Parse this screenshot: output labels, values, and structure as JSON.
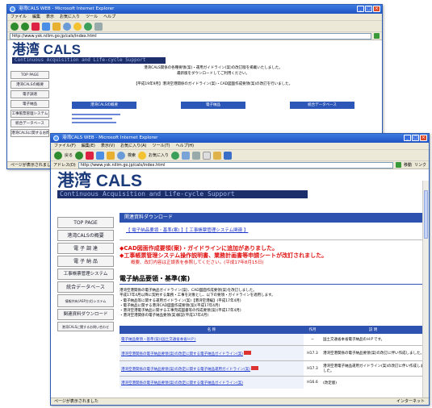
{
  "back": {
    "title": "港湾CALS WEB - Microsoft Internet Explorer",
    "menu": [
      "ファイル",
      "編集",
      "表示",
      "お気に入り",
      "ツール",
      "ヘルプ"
    ],
    "address": "http://www.ysk.nilim.go.jp/cals/index.html",
    "logo": "港湾 CALS",
    "subtitle": "Continuous Acquisition and Life-cycle Support",
    "notice1": "港湾CALS関係の各種要領(案)・運用ガイドライン(案)の改訂版を掲載いたしました。",
    "notice2": "最新版をダウンロードしてご利用ください。",
    "notice3": "【平成19年9月】港湾空港関係のガイドライン(案)・CAD図面作成要領(案)の改訂を行いました。",
    "nav": [
      "TOP PAGE",
      "港湾CALSの概要",
      "電子調達",
      "電子納品",
      "工事帳票管理システム",
      "統合データベース",
      "港湾CALSに関するお問い合わせ"
    ],
    "boxes": [
      "港湾CALSの概要",
      "電子納品",
      "統合データベース"
    ],
    "status": "ページが表示されました"
  },
  "front": {
    "title": "港湾CALS WEB - Microsoft Internet Explorer",
    "menu": [
      "ファイル(F)",
      "編集(E)",
      "表示(V)",
      "お気に入り(A)",
      "ツール(T)",
      "ヘルプ(H)"
    ],
    "toolbar": {
      "back": "戻る",
      "search": "検索",
      "favorites": "お気に入り"
    },
    "address_label": "アドレス(D)",
    "address": "http://www.ysk.nilim.go.jp/cals/index.html",
    "go": "移動",
    "links": "リンク",
    "logo": "港湾 CALS",
    "subtitle": "Continuous Acquisition and Life-cycle Support",
    "nav": [
      "TOP PAGE",
      "港湾CALSの概要",
      "電 子 調 達",
      "電 子 納 品",
      "工事帳票管理システム",
      "統合データベース",
      "情報共有(ASP方式)システム",
      "関連資料ダウンロード",
      "港湾CALSに関するお問い合わせ"
    ],
    "section_header": "関連資料ダウンロード",
    "top_links": "【 電子納品要領・基準(案) 】【 工事帳票管理システム関連 】",
    "red_line1": "◆CAD図面作成要領(案)・ガイドラインに追加がありました。",
    "red_line2": "◆工事帳票管理システム操作説明書、業務計画書等申請シートが改訂されました。",
    "red_line3": "概要、改訂内容は正誤表を参照してください。(平成17年8月15日)",
    "heading": "電子納品要領・基準(案)",
    "paragraph": [
      "港湾空港関係の電子納品ガイドライン(案)、CAD図面作成要領(案)を改訂しました。",
      "平成17年4月以降に契約する業務・工事を対象とし、以下の要領・ガイドラインを適用します。",
      "・電子納品等に関する運用ガイドライン(案)【港湾空港編】(平成17年4月)",
      "・電子納品に関する港湾CAD図面作成要領(案)(平成17年4月)",
      "・港湾空港電子納品に関する工事完成図書等の作成要領(案)(平成17年4月)",
      "・港湾空港関係の電子納品要領(案)解説(平成17年4月)"
    ],
    "table_headers": [
      "名 称",
      "作月",
      "説 明"
    ],
    "table_rows": [
      {
        "name": "電子納品要領・基準(案)(国土交通省本省ＨＰ)",
        "date": "─",
        "desc": "国土交通省本省電子納品のＨＰです。"
      },
      {
        "name": "港湾空港関係の電子納品要領(案)の改定に関する電子納品ガイドライン(案)",
        "date": "H17.3",
        "desc": "港湾空港関係の電子納品要領(案)の改訂に伴い作成しました。"
      },
      {
        "name": "港湾空港関係の電子納品要領(案)の改定に関する電子納品運用ガイドライン(案)",
        "date": "H17.3",
        "desc": "港湾空港電子納品運用ガイドライン(案)の改訂に伴い作成しました。"
      },
      {
        "name": "港湾空港関係の電子納品要領(案)の改定に関する電子納品ガイドライン(案)",
        "date": "H16.6",
        "desc": "(改定版)"
      }
    ],
    "status": "ページが表示されました",
    "zone": "インターネット"
  }
}
